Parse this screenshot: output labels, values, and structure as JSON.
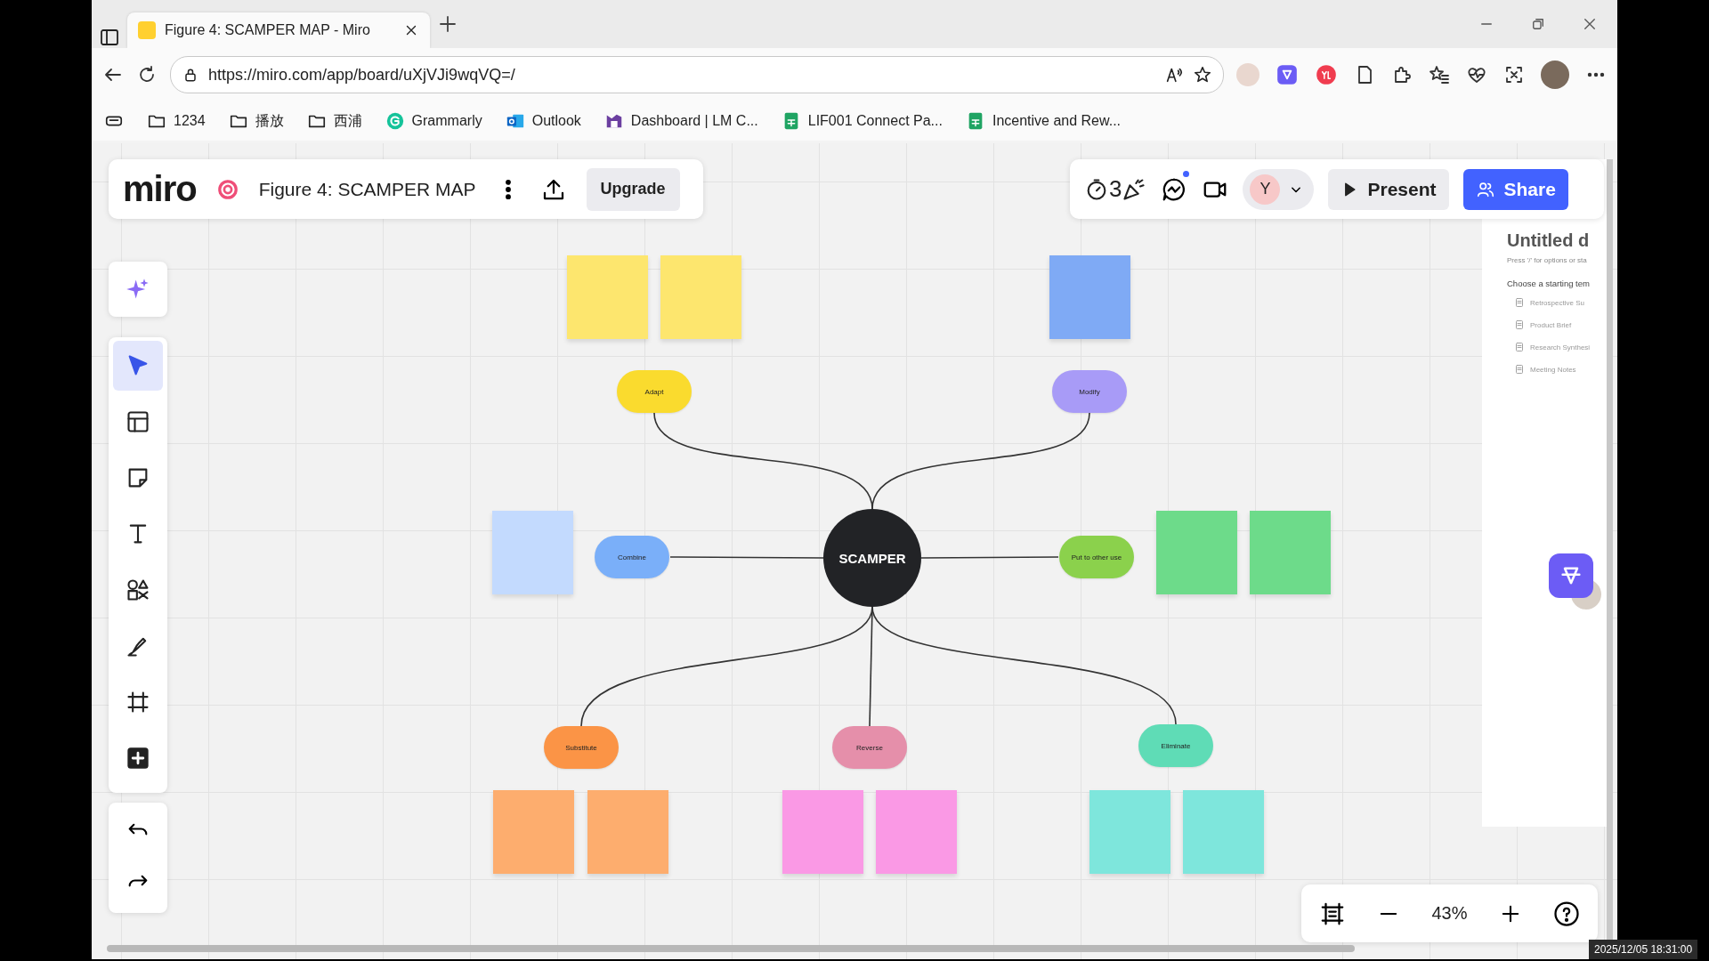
{
  "browser": {
    "tab": {
      "title": "Figure 4: SCAMPER MAP - Miro",
      "selected": true
    },
    "url": "https://miro.com/app/board/uXjVJi9wqVQ=/",
    "bookmarks": [
      {
        "kind": "folder",
        "label": "1234"
      },
      {
        "kind": "folder",
        "label": "播放"
      },
      {
        "kind": "folder",
        "label": "西浦"
      },
      {
        "kind": "grammarly",
        "label": "Grammarly"
      },
      {
        "kind": "outlook",
        "label": "Outlook"
      },
      {
        "kind": "dashboard",
        "label": "Dashboard | LM C..."
      },
      {
        "kind": "sheet",
        "label": "LIF001 Connect Pa..."
      },
      {
        "kind": "sheet",
        "label": "Incentive and Rew..."
      }
    ]
  },
  "board": {
    "logo": "miro",
    "title": "Figure 4: SCAMPER MAP",
    "upgrade": "Upgrade",
    "timer_digit": "3",
    "avatar": "Y",
    "present": "Present",
    "share": "Share",
    "zoom": "43%",
    "tools": [
      {
        "kind": "select",
        "selected": true
      },
      {
        "kind": "templates",
        "selected": false
      },
      {
        "kind": "sticky",
        "selected": false
      },
      {
        "kind": "text",
        "selected": false
      },
      {
        "kind": "shapes",
        "selected": false
      },
      {
        "kind": "pen",
        "selected": false
      },
      {
        "kind": "frame",
        "selected": false
      },
      {
        "kind": "more",
        "selected": false
      }
    ]
  },
  "doc_panel": {
    "title": "Untitled d",
    "hint": "Press '/' for options or sta",
    "subtitle": "Choose a starting tem",
    "templates": [
      "Retrospective Su",
      "Product Brief",
      "Research Synthesi",
      "Meeting Notes"
    ]
  },
  "mind_map": {
    "center": "SCAMPER",
    "branches": [
      {
        "label": "Adapt",
        "color": "#fadb2e",
        "stickies": [
          {
            "color": "#fde66e"
          },
          {
            "color": "#fde66e"
          }
        ]
      },
      {
        "label": "Modify",
        "color": "#a89bf7",
        "stickies": [
          {
            "color": "#7faaf5"
          }
        ]
      },
      {
        "label": "Combine",
        "color": "#7aaff9",
        "stickies": [
          {
            "color": "#c3dafe"
          }
        ]
      },
      {
        "label": "Put to other use",
        "color": "#8bd14c",
        "stickies": [
          {
            "color": "#6ddb8a"
          },
          {
            "color": "#6ddb8a"
          }
        ]
      },
      {
        "label": "Substitute",
        "color": "#fb9446",
        "stickies": [
          {
            "color": "#fdad6e"
          },
          {
            "color": "#fdad6e"
          }
        ]
      },
      {
        "label": "Reverse",
        "color": "#e58faa",
        "stickies": [
          {
            "color": "#fa99e5"
          },
          {
            "color": "#fa99e5"
          }
        ]
      },
      {
        "label": "Eliminate",
        "color": "#5fdcb6",
        "stickies": [
          {
            "color": "#7ee6dc"
          },
          {
            "color": "#7ee6dc"
          }
        ]
      }
    ]
  },
  "timestamp": "2025/12/05 18:31:00"
}
